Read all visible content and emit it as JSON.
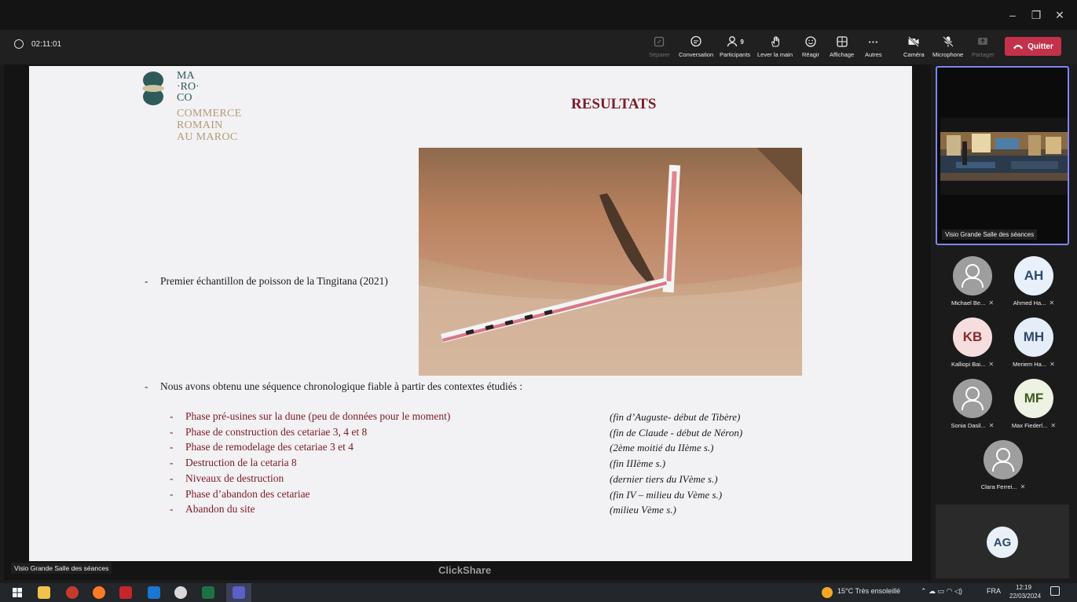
{
  "meeting": {
    "elapsed_time": "02:11:01",
    "toolbar": [
      {
        "label": "Séparer",
        "icon": "split-icon",
        "enabled": false
      },
      {
        "label": "Conversation",
        "icon": "chat-icon",
        "enabled": true
      },
      {
        "label": "Participants",
        "icon": "participants-icon",
        "enabled": true,
        "count": "9"
      },
      {
        "label": "Lever la main",
        "icon": "raise-hand-icon",
        "enabled": true
      },
      {
        "label": "Réagir",
        "icon": "react-icon",
        "enabled": true
      },
      {
        "label": "Affichage",
        "icon": "view-icon",
        "enabled": true
      },
      {
        "label": "Autres",
        "icon": "more-icon",
        "enabled": true
      },
      {
        "label": "Caméra",
        "icon": "camera-off-icon",
        "enabled": true
      },
      {
        "label": "Microphone",
        "icon": "mic-off-icon",
        "enabled": true
      },
      {
        "label": "Partager",
        "icon": "share-icon",
        "enabled": false
      }
    ],
    "quit_label": "Quitter",
    "quit_color": "#c4314b"
  },
  "slide": {
    "logo_lines": [
      "MA",
      "·RO·",
      "CO"
    ],
    "logo_sub": [
      "COMMERCE",
      "ROMAIN",
      "AU MAROC"
    ],
    "title": "RESULTATS",
    "bullet1": "Premier échantillon de poisson de la Tingitana (2021)",
    "bullet2": "Nous avons obtenu une séquence chronologique fiable à partir des contextes étudiés :",
    "phases": [
      {
        "label": "Phase pré-usines sur la dune (peu de données pour le moment)",
        "date": "(fin d’Auguste- début de Tibère)"
      },
      {
        "label": "Phase de construction des cetariae 3, 4 et 8",
        "date": "(fin de Claude - début de Néron)"
      },
      {
        "label": "Phase de remodelage des cetariae 3 et 4",
        "date": "(2ème moitié du IIème s.)"
      },
      {
        "label": "Destruction de la cetaria 8",
        "date": "(fin  IIIème s.)"
      },
      {
        "label": "Niveaux de destruction",
        "date": "(dernier tiers du IVème s.)"
      },
      {
        "label": "Phase d’abandon des cetariae",
        "date": " (fin IV – milieu du Vème s.)"
      },
      {
        "label": "Abandon du site",
        "date": "(milieu Vème s.)"
      }
    ],
    "accent_color": "#7a1c24"
  },
  "stage_caption": "Visio Grande Salle des séances",
  "clickshare": "ClickShare",
  "featured": {
    "name": "Visio Grande Salle des séances"
  },
  "participants": [
    {
      "name": "Michael Be...",
      "initials": "",
      "color": "#9e9e9e",
      "text_color": "#ffffff"
    },
    {
      "name": "Ahmed Ha...",
      "initials": "AH",
      "color": "#e8f0fb",
      "text_color": "#2d4a6e"
    },
    {
      "name": "Kalliopi Bai...",
      "initials": "KB",
      "color": "#f5dedd",
      "text_color": "#8a2a2a"
    },
    {
      "name": "Meriem Ha...",
      "initials": "MH",
      "color": "#e5eef8",
      "text_color": "#2d4a6e"
    },
    {
      "name": "Sonia Dasil...",
      "initials": "",
      "color": "#9e9e9e",
      "text_color": "#ffffff"
    },
    {
      "name": "Max Fiederl...",
      "initials": "MF",
      "color": "#edf2e2",
      "text_color": "#3e5a1e"
    },
    {
      "name": "Clara Ferrei...",
      "initials": "",
      "color": "#9e9e9e",
      "text_color": "#ffffff"
    }
  ],
  "self": {
    "initials": "AG"
  },
  "taskbar": {
    "weather": "15°C  Très ensoleillé",
    "lang": "FRA",
    "time": "12:19",
    "date": "22/03/2024"
  }
}
